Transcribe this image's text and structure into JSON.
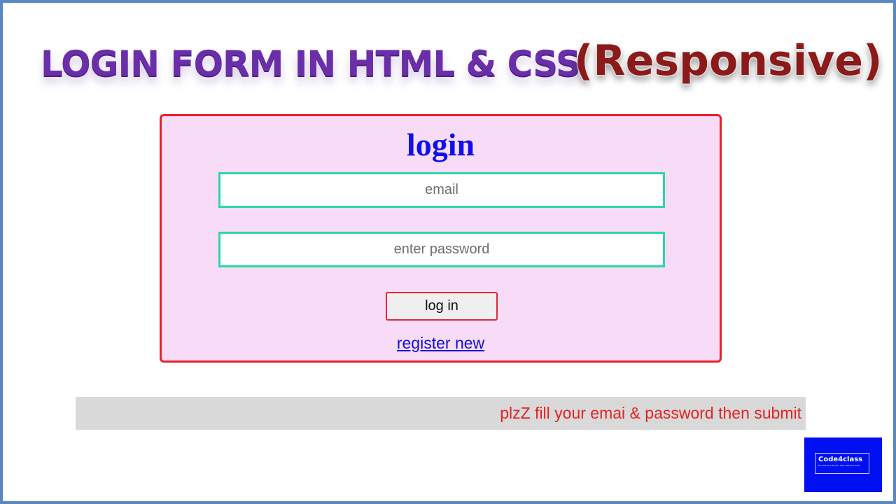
{
  "headline": {
    "main": "LOGIN FORM IN HTML & CSS",
    "accent": "(Responsive)"
  },
  "form": {
    "title": "login",
    "email_placeholder": "email",
    "password_placeholder": "enter password",
    "submit_label": "log in",
    "register_label": "register new"
  },
  "message": {
    "text": "plzZ fill your emai & password then submit"
  },
  "brand": {
    "name": "Code4class",
    "tagline": "DO WHAT'S RIGHT, NOT WHAT'S EASY"
  },
  "colors": {
    "frame_border": "#5b87c2",
    "headline_main": "#6a2fa8",
    "headline_accent": "#8b1a1a",
    "card_background": "#f8dcf7",
    "card_border": "#e8202a",
    "title": "#1010e8",
    "field_border": "#2bd7a8",
    "button_border": "#dd2a38",
    "link": "#1010d8",
    "message_bar": "#d9d9d9",
    "message_text": "#e22424",
    "brand_background": "#0010f0"
  }
}
